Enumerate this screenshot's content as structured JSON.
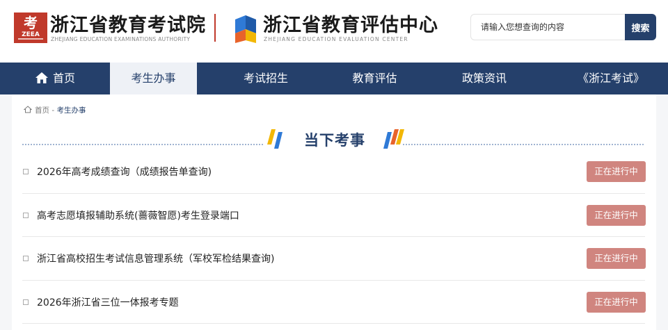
{
  "header": {
    "org1_name": "浙江省教育考试院",
    "org1_en": "ZHEJIANG EDUCATION EXAMINATIONS AUTHORITY",
    "org1_logo_text": "ZEEA",
    "org2_name": "浙江省教育评估中心",
    "org2_en": "ZHEJIANG EDUCATION EVALUATION CENTER",
    "search_placeholder": "请输入您想查询的内容",
    "search_button": "搜索"
  },
  "nav": {
    "items": [
      {
        "label": "首页",
        "icon": "home-icon"
      },
      {
        "label": "考生办事"
      },
      {
        "label": "考试招生"
      },
      {
        "label": "教育评估"
      },
      {
        "label": "政策资讯"
      },
      {
        "label": "《浙江考试》"
      }
    ],
    "active_index": 1
  },
  "breadcrumb": {
    "home": "首页",
    "separator": " - ",
    "current": "考生办事"
  },
  "section": {
    "title": "当下考事"
  },
  "items": [
    {
      "title": "2026年高考成绩查询（成绩报告单查询)",
      "status": "正在进行中"
    },
    {
      "title": "高考志愿填报辅助系统(蔷薇智愿)考生登录端口",
      "status": "正在进行中"
    },
    {
      "title": "浙江省高校招生考试信息管理系统（军校军检结果查询)",
      "status": "正在进行中"
    },
    {
      "title": "2026年浙江省三位一体报考专题",
      "status": "正在进行中"
    }
  ],
  "colors": {
    "primary": "#25406b",
    "badge": "#d0857f",
    "brand_red": "#c0392b",
    "accent_yellow": "#f2b705",
    "accent_blue": "#2f7ad6"
  }
}
